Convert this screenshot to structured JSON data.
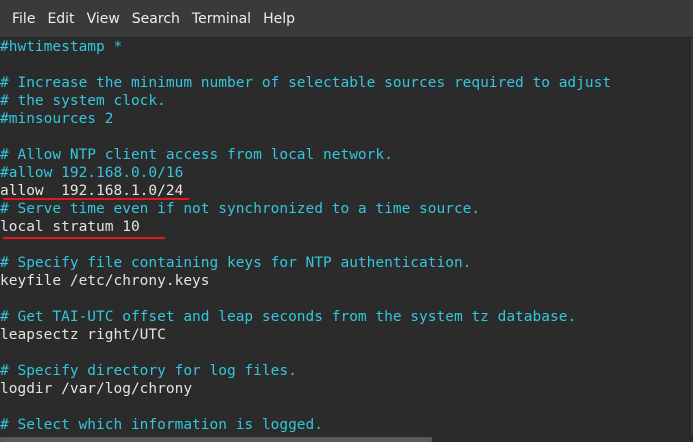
{
  "menu": {
    "items": [
      "File",
      "Edit",
      "View",
      "Search",
      "Terminal",
      "Help"
    ]
  },
  "terminal": {
    "lines": [
      "#hwtimestamp *",
      "",
      "# Increase the minimum number of selectable sources required to adjust",
      "# the system clock.",
      "#minsources 2",
      "",
      "# Allow NTP client access from local network.",
      "#allow 192.168.0.0/16",
      "allow  192.168.1.0/24",
      "# Serve time even if not synchronized to a time source.",
      "local stratum 10",
      "",
      "# Specify file containing keys for NTP authentication.",
      "keyfile /etc/chrony.keys",
      "",
      "# Get TAI-UTC offset and leap seconds from the system tz database.",
      "leapsectz right/UTC",
      "",
      "# Specify directory for log files.",
      "logdir /var/log/chrony",
      "",
      "# Select which information is logged."
    ]
  },
  "colors": {
    "comment": "#33c7de",
    "text": "#e3e3e3",
    "background": "#2b2b2b",
    "menubar": "#3a3a3a",
    "annotation": "#e0191f"
  }
}
